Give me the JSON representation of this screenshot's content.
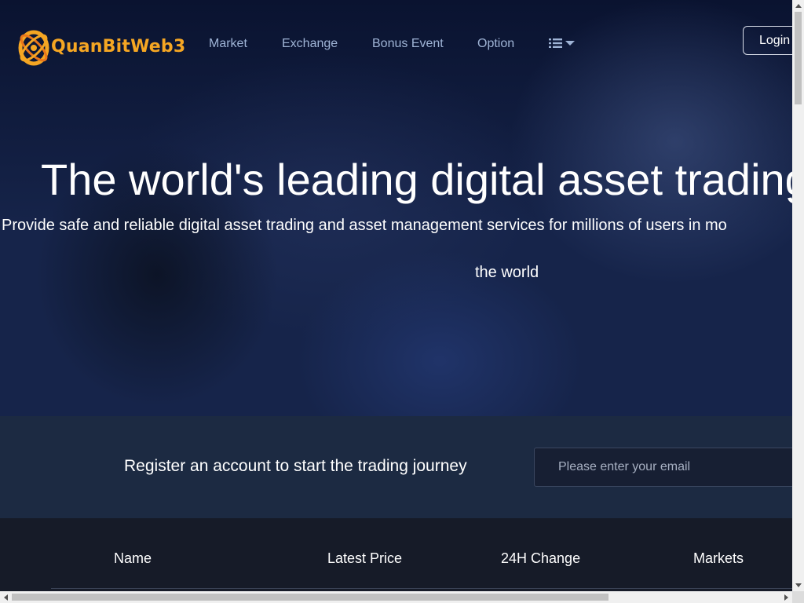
{
  "brand": {
    "name": "QuanBitWeb3",
    "color": "#f5a623"
  },
  "nav": {
    "items": [
      {
        "label": "Market"
      },
      {
        "label": "Exchange"
      },
      {
        "label": "Bonus Event"
      },
      {
        "label": "Option"
      }
    ],
    "menu_icon": "list-icon",
    "dropdown_icon": "caret-down-icon",
    "login_label": "Login"
  },
  "hero": {
    "title": "The world's leading digital asset trading",
    "subtitle_line1": "Provide safe and reliable digital asset trading and asset management services for millions of users in mo",
    "subtitle_line2": "the world"
  },
  "register": {
    "text": "Register an account to start the trading journey",
    "email_placeholder": "Please enter your email"
  },
  "market_table": {
    "headers": [
      "Name",
      "Latest Price",
      "24H Change",
      "Markets"
    ]
  },
  "colors": {
    "nav_text": "#9fb4d6",
    "hero_bg": "#16244a",
    "register_bg": "#1c2a42",
    "table_bg": "#161b28"
  }
}
